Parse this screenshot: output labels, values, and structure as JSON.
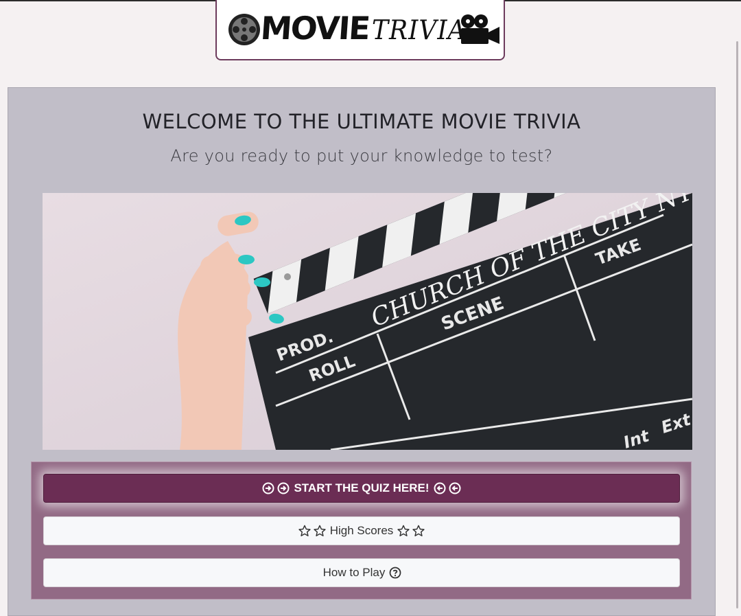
{
  "logo": {
    "word1": "MOVIE",
    "word2": "TRIVIA",
    "reel_icon": "film-reel-icon",
    "camera_icon": "movie-camera-icon"
  },
  "welcome": {
    "title": "WELCOME TO THE ULTIMATE MOVIE TRIVIA",
    "subtitle": "Are you ready to put your knowledge to test?"
  },
  "hero": {
    "clapper_prod_text": "CHURCH OF THE CITY NYC",
    "labels": [
      "PROD.",
      "SCENE",
      "TAKE",
      "ROLL",
      "Int",
      "Ext"
    ]
  },
  "buttons": {
    "start": {
      "label": "START THE QUIZ HERE!",
      "icon": "arrow-circle-right-icon"
    },
    "high_scores": {
      "label": "High Scores",
      "icon": "star-outline-icon"
    },
    "how_to_play": {
      "label": "How to Play",
      "icon": "question-circle-icon"
    }
  },
  "colors": {
    "page_bg": "#f5f1f2",
    "panel_bg": "#c1bec8",
    "button_panel_bg": "#926a85",
    "start_button": "#6b2d54",
    "light_button": "#f7f8fa",
    "logo_border": "#6c3a5c"
  }
}
